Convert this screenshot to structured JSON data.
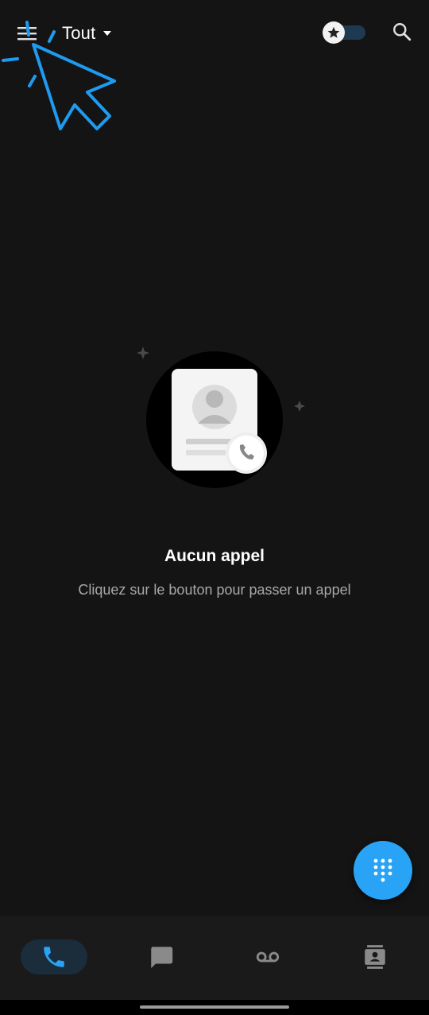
{
  "header": {
    "filter_label": "Tout",
    "menu_icon": "hamburger-menu-icon",
    "filter_dropdown_icon": "caret-down-icon",
    "favorites_toggle": {
      "icon": "star-icon",
      "on": false
    },
    "search_icon": "search-icon"
  },
  "empty_state": {
    "illustration_icon": "contact-card-phone-icon",
    "title": "Aucun appel",
    "subtitle": "Cliquez sur le bouton pour passer un appel"
  },
  "fab": {
    "icon": "dialpad-icon"
  },
  "bottom_nav": {
    "items": [
      {
        "icon": "phone-icon",
        "active": true
      },
      {
        "icon": "chat-icon",
        "active": false
      },
      {
        "icon": "voicemail-icon",
        "active": false
      },
      {
        "icon": "contacts-icon",
        "active": false
      }
    ]
  },
  "colors": {
    "background": "#141414",
    "accent": "#29a3f5",
    "nav_active_bg": "#1b2c3b",
    "cursor": "#1e9bf0"
  }
}
